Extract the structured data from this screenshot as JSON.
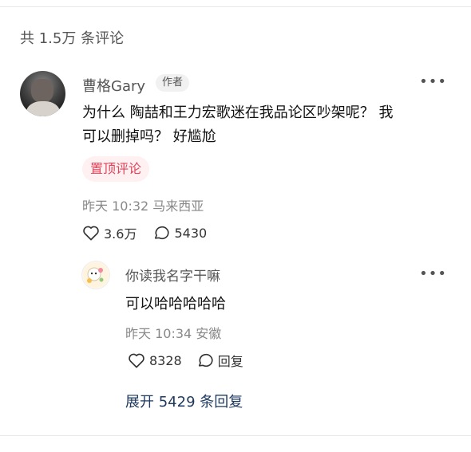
{
  "comments_header": {
    "count_text": "共 1.5万 条评论"
  },
  "main_comment": {
    "author": "曹格Gary",
    "author_badge": "作者",
    "content_line1": "为什么 陶喆和王力宏歌迷在我品论区吵架呢？ 我",
    "content_line2": "可以删掉吗？ 好尴尬",
    "pin_label": "置顶评论",
    "meta": "昨天 10:32 马来西亚",
    "likes": "3.6万",
    "replies_count": "5430",
    "more_icon": "more-dots-icon"
  },
  "reply": {
    "author": "你读我名字干嘛",
    "content": "可以哈哈哈哈哈",
    "meta": "昨天 10:34 安徽",
    "likes": "8328",
    "reply_label": "回复",
    "more_icon": "more-dots-icon"
  },
  "expand": {
    "label": "展开 5429 条回复"
  },
  "colors": {
    "pin_text": "#e0435a",
    "pin_bg": "#fff0f2",
    "expand_text": "#1f3a60"
  }
}
